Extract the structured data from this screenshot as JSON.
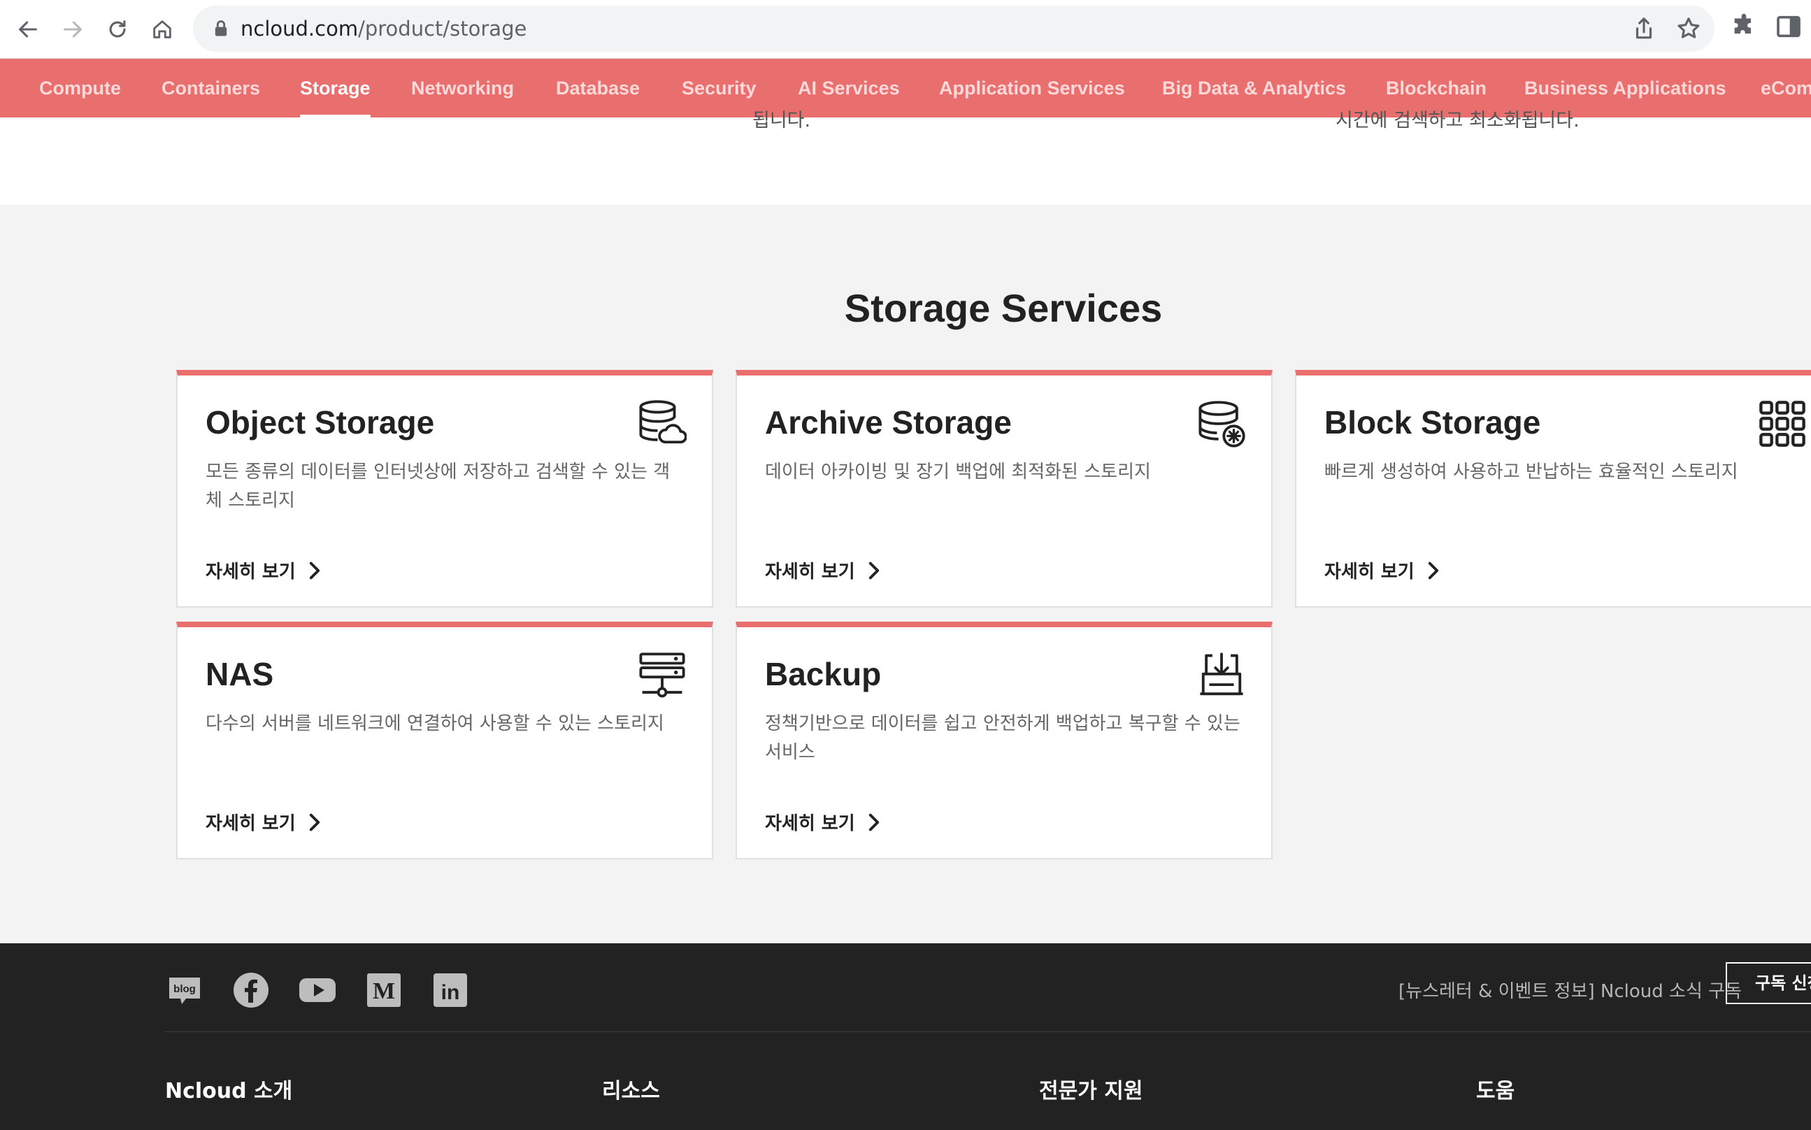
{
  "browser": {
    "url_host": "ncloud.com",
    "url_path": "/product/storage"
  },
  "category_nav": {
    "items": [
      {
        "label": "Compute"
      },
      {
        "label": "Containers"
      },
      {
        "label": "Storage",
        "active": true
      },
      {
        "label": "Networking"
      },
      {
        "label": "Database"
      },
      {
        "label": "Security"
      },
      {
        "label": "AI Services"
      },
      {
        "label": "Application Services"
      },
      {
        "label": "Big Data & Analytics"
      },
      {
        "label": "Blockchain"
      },
      {
        "label": "Business Applications"
      },
      {
        "label": "eCom"
      }
    ]
  },
  "cutoff_text": {
    "left": "됩니다.",
    "right": "시간에 검색하고 최소화됩니다."
  },
  "services": {
    "title": "Storage Services",
    "link_label": "자세히 보기",
    "cards": [
      {
        "title": "Object Storage",
        "desc": "모든 종류의 데이터를 인터넷상에 저장하고 검색할 수 있는 객체 스토리지",
        "icon": "database-cloud-icon"
      },
      {
        "title": "Archive Storage",
        "desc": "데이터 아카이빙 및 장기 백업에 최적화된 스토리지",
        "icon": "database-gear-icon"
      },
      {
        "title": "Block Storage",
        "desc": "빠르게 생성하여 사용하고 반납하는 효율적인 스토리지",
        "icon": "grid-blocks-icon"
      },
      {
        "title": "NAS",
        "desc": "다수의 서버를 네트워크에 연결하여 사용할 수 있는 스토리지",
        "icon": "server-network-icon"
      },
      {
        "title": "Backup",
        "desc": "정책기반으로 데이터를 쉽고 안전하게 백업하고 복구할 수 있는 서비스",
        "icon": "download-tray-icon"
      }
    ]
  },
  "footer": {
    "social": [
      {
        "name": "blog-icon",
        "label": "blog"
      },
      {
        "name": "facebook-icon"
      },
      {
        "name": "youtube-icon"
      },
      {
        "name": "medium-icon",
        "label": "M"
      },
      {
        "name": "linkedin-icon",
        "label": "in"
      }
    ],
    "newsletter_text": "[뉴스레터 & 이벤트 정보] Ncloud 소식 구독",
    "subscribe_label": "구독 신청",
    "columns": [
      {
        "title": "Ncloud 소개"
      },
      {
        "title": "리소스"
      },
      {
        "title": "전문가 지원"
      },
      {
        "title": "도움"
      }
    ]
  },
  "colors": {
    "brand_red": "#e96e6e",
    "footer_bg": "#222222",
    "section_bg": "#f3f3f3"
  }
}
